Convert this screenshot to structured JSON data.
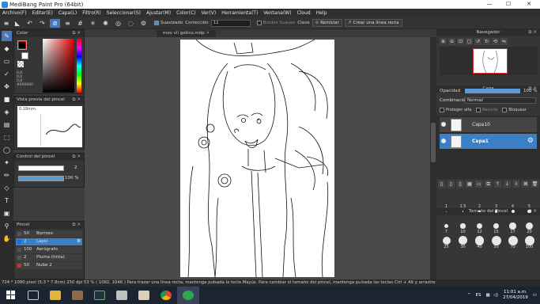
{
  "window": {
    "title": "MediBang Paint Pro (64bit)",
    "minimize": "—",
    "maximize": "☐",
    "close": "✕"
  },
  "menu": [
    "Archivo(F)",
    "Editar(E)",
    "Capa(L)",
    "Filtro(R)",
    "Seleccionar(S)",
    "Ajustar(M)",
    "Color(C)",
    "Ver(V)",
    "Herramienta(T)",
    "Ventana(W)",
    "Cloud",
    "Help"
  ],
  "toolbar": {
    "suavizado_label": "Suavizado",
    "correccion_label": "Corrección",
    "correccion_value": "11",
    "bordes_label": "Bordes Suaves",
    "clave_label": "Clave",
    "reiniciar_label": "Reiniciar",
    "linea_label": "Crear una línea recta"
  },
  "color_panel": {
    "title": "Color",
    "hsv": [
      "0,0",
      "0,0",
      "0,0"
    ],
    "hex": "#000000",
    "fg": "#000000",
    "bg": "#ffffff"
  },
  "brush_preview": {
    "title": "Vista previa del pincel",
    "size": "0.18mm"
  },
  "brush_control": {
    "title": "Control del pincel",
    "size_value": "2",
    "opacity_value": "100 %"
  },
  "brush_list": {
    "title": "Pincel",
    "items": [
      {
        "size": "50",
        "name": "Borroso",
        "color": "#555555",
        "selected": false
      },
      {
        "size": "2",
        "name": "Lápiz",
        "color": "#1c6dd0",
        "selected": true
      },
      {
        "size": "100",
        "name": "Aerógrafo",
        "color": "#555555",
        "selected": false
      },
      {
        "size": "2",
        "name": "Pluma (tinta)",
        "color": "#555555",
        "selected": false
      },
      {
        "size": "50",
        "name": "Nube 2",
        "color": "#c0392b",
        "selected": false
      }
    ]
  },
  "document": {
    "tab": "mov vil gotico.mdp"
  },
  "navigator": {
    "title": "Navegador"
  },
  "layers": {
    "title": "Capa",
    "opacity_label": "Opacidad",
    "opacity_value": "100 %",
    "blend_label": "Combinación",
    "blend_value": "Normal",
    "protect_alpha": "Proteger alfa",
    "clip": "Recorte",
    "lock": "Bloquear",
    "items": [
      {
        "name": "Capa10",
        "selected": false
      },
      {
        "name": "Capa1",
        "selected": true
      }
    ]
  },
  "brush_size": {
    "title": "Tamaño del Pincel",
    "labels": [
      "1",
      "1.5",
      "2",
      "3",
      "4",
      "5",
      "7",
      "10",
      "12",
      "15",
      "17",
      "20",
      "25",
      "30",
      "40",
      "50",
      "70",
      "100"
    ]
  },
  "status": {
    "text": "724 * 1080 pixel  (5.3 * 7.8cm)  250 dpi  53 %  ( 1082, 1046 )  Para trazar una línea recta, mantenga pulsada la tecla Mayús. Para cambiar el tamaño del pincel, mantenga pulsada las teclas Ctrl + Alt y arrastre"
  },
  "taskbar": {
    "lang": "ES",
    "time": "11:01 a.m.",
    "date": "27/04/2019"
  },
  "colors": {
    "accent": "#4a78b6",
    "selected_layer": "#3b7fc6",
    "opacity_bar": "#5b9bd5"
  }
}
